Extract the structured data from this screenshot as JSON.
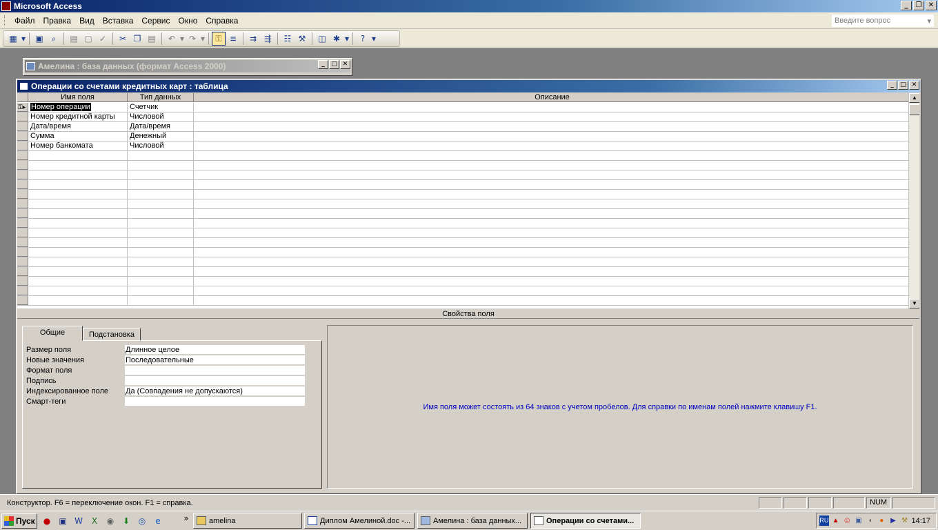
{
  "app": {
    "title": "Microsoft Access",
    "minimize": "_",
    "maximize": "❐",
    "close": "✕"
  },
  "menu": {
    "items": [
      "Файл",
      "Правка",
      "Вид",
      "Вставка",
      "Сервис",
      "Окно",
      "Справка"
    ],
    "help_placeholder": "Введите вопрос"
  },
  "db_window": {
    "title": "Амелина : база данных (формат Access 2000)"
  },
  "table_window": {
    "title": "Операции со счетами кредитных карт : таблица",
    "columns": [
      "Имя поля",
      "Тип данных",
      "Описание"
    ],
    "rows": [
      {
        "field": "Номер операции",
        "type": "Счетчик",
        "desc": ""
      },
      {
        "field": "Номер кредитной карты",
        "type": "Числовой",
        "desc": ""
      },
      {
        "field": "Дата/время",
        "type": "Дата/время",
        "desc": ""
      },
      {
        "field": "Сумма",
        "type": "Денежный",
        "desc": ""
      },
      {
        "field": "Номер банкомата",
        "type": "Числовой",
        "desc": ""
      }
    ],
    "props_header": "Свойства поля",
    "tabs": [
      "Общие",
      "Подстановка"
    ],
    "properties": [
      {
        "label": "Размер поля",
        "value": "Длинное целое"
      },
      {
        "label": "Новые значения",
        "value": "Последовательные"
      },
      {
        "label": "Формат поля",
        "value": ""
      },
      {
        "label": "Подпись",
        "value": ""
      },
      {
        "label": "Индексированное поле",
        "value": "Да (Совпадения не допускаются)"
      },
      {
        "label": "Смарт-теги",
        "value": ""
      }
    ],
    "hint": "Имя поля может состоять из 64 знаков с учетом пробелов.  Для справки по именам полей нажмите клавишу F1."
  },
  "status": {
    "text": "Конструктор.  F6 = переключение окон.  F1 = справка.",
    "num": "NUM"
  },
  "taskbar": {
    "start": "Пуск",
    "more": "»",
    "buttons": [
      {
        "label": "amelina"
      },
      {
        "label": "Диплом Амелиной.doc -..."
      },
      {
        "label": "Амелина : база данных..."
      },
      {
        "label": "Операции со счетами..."
      }
    ],
    "lang": "RU",
    "clock": "14:17"
  },
  "colors": {
    "title_active": "#0a246a",
    "hint_text": "#0000c0",
    "mdi_bg": "#808080"
  }
}
